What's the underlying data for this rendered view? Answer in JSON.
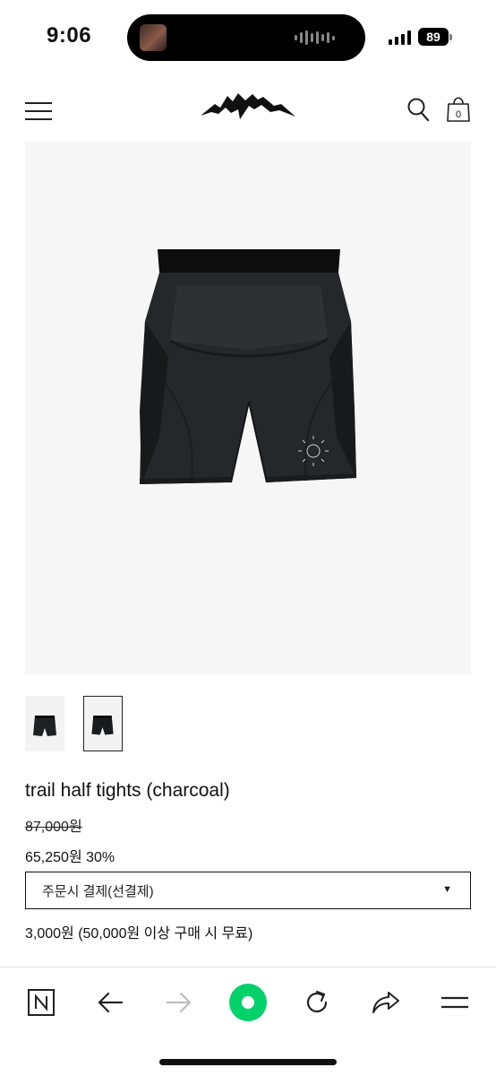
{
  "status_bar": {
    "time": "9:06",
    "battery": "89"
  },
  "product": {
    "title": "trail half tights (charcoal)",
    "original_price": "87,000원",
    "sale_price": "65,250원",
    "discount": "30%",
    "payment_option": "주문시 결제(선결제)",
    "shipping_note": "3,000원 (50,000원 이상 구매 시 무료)"
  },
  "header": {
    "cart_count": "0"
  },
  "icons": {
    "menu": "hamburger-icon",
    "search": "search-icon",
    "cart": "shopping-bag-icon",
    "browser_home": "naver-n-icon",
    "back": "arrow-left-icon",
    "forward": "arrow-right-icon",
    "center": "green-circle-icon",
    "reload": "refresh-icon",
    "share": "share-icon",
    "more": "menu-icon"
  },
  "colors": {
    "accent_green": "#03d26b",
    "text": "#111111",
    "image_bg": "#f6f6f6"
  }
}
